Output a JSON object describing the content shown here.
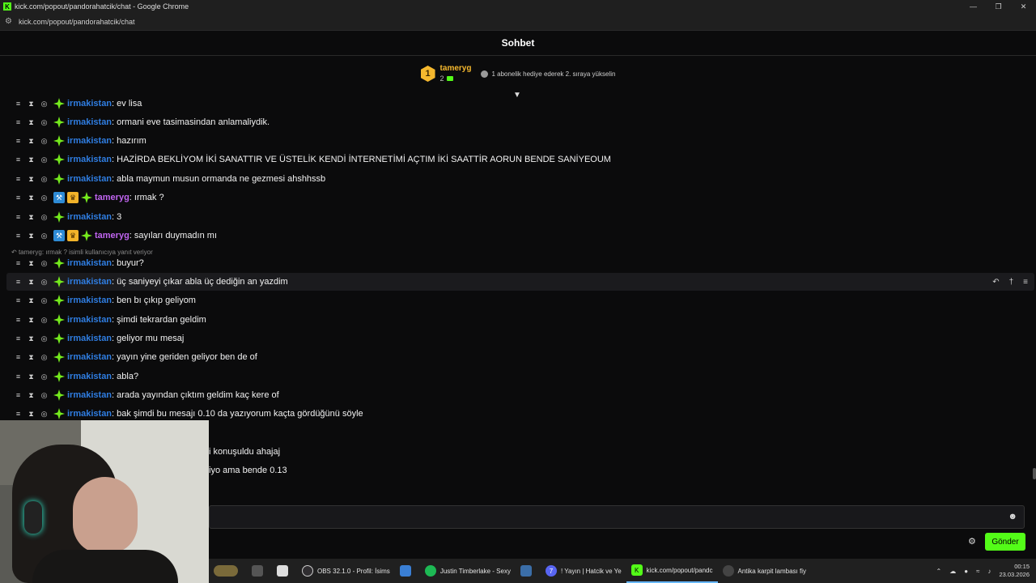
{
  "window": {
    "title": "kick.com/popout/pandorahatcik/chat - Google Chrome",
    "url": "kick.com/popout/pandorahatcik/chat"
  },
  "chat": {
    "header": "Sohbet",
    "leaderboard": {
      "rank": "1",
      "user": "tameryg",
      "count": "2",
      "gift_text": "1 abonelik hediye ederek 2. sıraya yükselin"
    },
    "reply_hint": "tameryg: ırmak ? isimli kullanıcıya yanıt veriyor",
    "messages": [
      {
        "user": "irmakistan",
        "text": ": ev lisa"
      },
      {
        "user": "irmakistan",
        "text": ": ormani eve tasimasindan anlamaliydik."
      },
      {
        "user": "irmakistan",
        "text": ": hazırım"
      },
      {
        "user": "irmakistan",
        "text": ": HAZİRDA BEKLİYOM İKİ SANATTIR VE ÜSTELİK KENDİ İNTERNETİMİ AÇTIM İKİ SAATTİR AORUN BENDE SANİYEOUM"
      },
      {
        "user": "irmakistan",
        "text": ": abla maymun musun ormanda ne gezmesi ahshhssb"
      },
      {
        "user": "tameryg",
        "text": ": ırmak ?"
      },
      {
        "user": "irmakistan",
        "text": ": 3"
      },
      {
        "user": "tameryg",
        "text": ": sayıları duymadın mı"
      },
      {
        "user": "irmakistan",
        "text": ": buyur?"
      },
      {
        "user": "irmakistan",
        "text": ": üç saniyeyi çıkar abla üç dediğin an yazdim"
      },
      {
        "user": "irmakistan",
        "text": ": ben bı çıkıp geliyom"
      },
      {
        "user": "irmakistan",
        "text": ": şimdi tekrardan geldim"
      },
      {
        "user": "irmakistan",
        "text": ": geliyor mu mesaj"
      },
      {
        "user": "irmakistan",
        "text": ": yayın yine geriden geliyor ben de of"
      },
      {
        "user": "irmakistan",
        "text": ": abla?"
      },
      {
        "user": "irmakistan",
        "text": ": arada yayından çıktım geldim kaç kere of"
      },
      {
        "user": "irmakistan",
        "text": ": bak şimdi bu mesajı 0.10 da yazıyorum kaçta gördüğünü söyle"
      }
    ],
    "partial_lines": [
      "i konuşuldu ahajaj",
      "iyo ama bende 0.13"
    ],
    "send_label": "Gönder"
  },
  "taskbar": {
    "items": [
      "OBS 32.1.0 - Profil: İsims",
      "Justin Timberlake - Sexy",
      "! Yayın | Hatcik ve Ye",
      "kick.com/popout/pandc",
      "Antika karpit lambası fiy"
    ],
    "discord_badge": "7",
    "time": "00:15",
    "date": "23.03.2026"
  },
  "colors": {
    "brand": "#53fc18",
    "user_irmakistan": "#2f7de1",
    "user_tameryg": "#c065f0"
  }
}
